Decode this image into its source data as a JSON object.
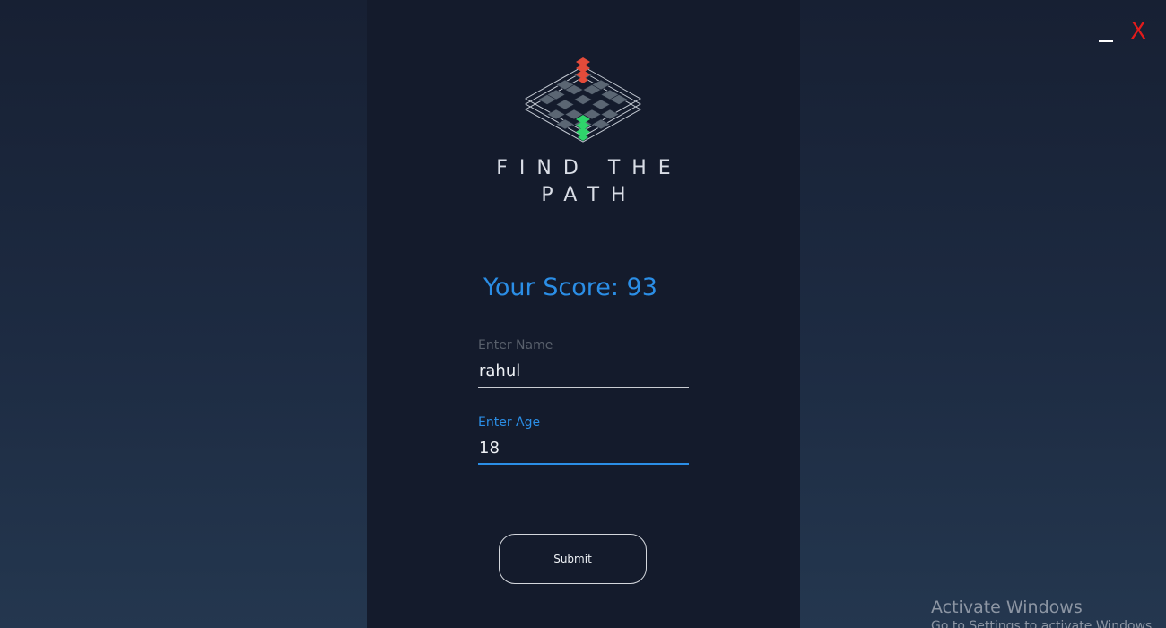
{
  "window": {
    "minimize_label": "_",
    "close_label": "X",
    "close_color": "#e21b1b"
  },
  "app": {
    "title_line1": "FIND THE",
    "title_line2": "PATH",
    "logo_icon": "isometric-maze-logo-icon",
    "logo_colors": {
      "start": "#e44b3a",
      "end": "#2fd46b",
      "tiles": "#5b6673"
    }
  },
  "score": {
    "text": "Your Score: 93"
  },
  "form": {
    "name_label": "Enter Name",
    "name_value": "rahul",
    "age_label": "Enter Age",
    "age_value": "18",
    "submit_label": "Submit"
  },
  "theme": {
    "accent": "#2b8ee6",
    "panel": "#141b2c"
  },
  "watermark": {
    "title": "Activate Windows",
    "subtitle": "Go to Settings to activate Windows."
  }
}
